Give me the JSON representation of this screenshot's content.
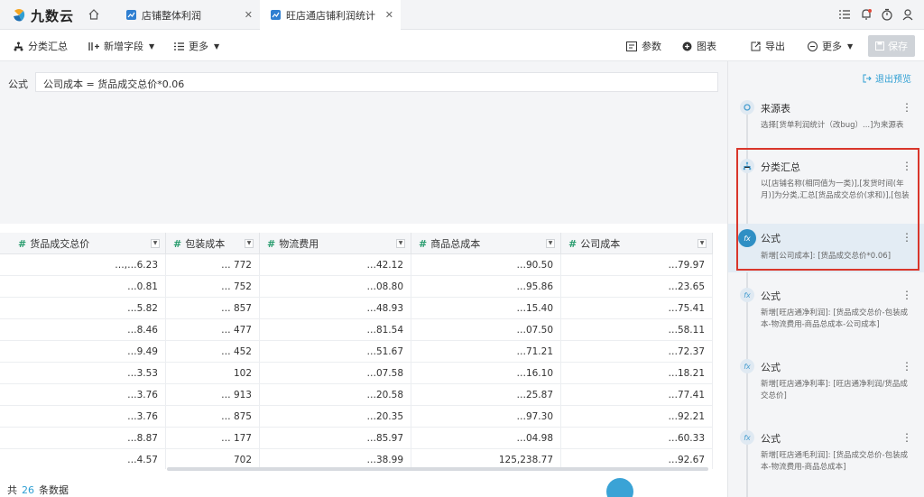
{
  "app": {
    "logo_text": "九数云",
    "tabs": [
      {
        "label": "店铺整体利润",
        "active": false
      },
      {
        "label": "旺店通店铺利润统计",
        "active": true
      }
    ]
  },
  "toolbar": {
    "group_summary": "分类汇总",
    "add_field": "新增字段",
    "more_left": "更多",
    "params": "参数",
    "chart": "图表",
    "export": "导出",
    "more_right": "更多",
    "save": "保存"
  },
  "formula": {
    "label": "公式",
    "value": "公司成本 = 货品成交总价*0.06"
  },
  "table": {
    "columns": [
      "货品成交总价",
      "包装成本",
      "物流费用",
      "商品总成本",
      "公司成本"
    ],
    "rows": [
      [
        "…,…6.23",
        "… 772",
        "…42.12",
        "…90.50",
        "…79.97"
      ],
      [
        "…0.81",
        "… 752",
        "…08.80",
        "…95.86",
        "…23.65"
      ],
      [
        "…5.82",
        "… 857",
        "…48.93",
        "…15.40",
        "…75.41"
      ],
      [
        "…8.46",
        "… 477",
        "…81.54",
        "…07.50",
        "…58.11"
      ],
      [
        "…9.49",
        "… 452",
        "…51.67",
        "…71.21",
        "…72.37"
      ],
      [
        "…3.53",
        "102",
        "…07.58",
        "…16.10",
        "…18.21"
      ],
      [
        "…3.76",
        "… 913",
        "…20.58",
        "…25.87",
        "…77.41"
      ],
      [
        "…3.76",
        "… 875",
        "…20.35",
        "…97.30",
        "…92.21"
      ],
      [
        "…8.87",
        "… 177",
        "…85.97",
        "…04.98",
        "…60.33"
      ],
      [
        "…4.57",
        "702",
        "…38.99",
        "125,238.77",
        "…92.67"
      ]
    ]
  },
  "footer": {
    "prefix": "共",
    "count": "26",
    "suffix": "条数据"
  },
  "panel": {
    "exit_preview": "退出预览",
    "steps": [
      {
        "title": "来源表",
        "desc": "选择[货单利润统计（改bug）...]为来源表"
      },
      {
        "title": "分类汇总",
        "desc": "以[店铺名称(相同值为一类)],[发货时间(年月)]为分类,汇总[货品成交总价(求和)],[包装"
      },
      {
        "title": "公式",
        "desc": "新增[公司成本]: [货品成交总价*0.06]"
      },
      {
        "title": "公式",
        "desc": "新增[旺店通净利润]: [货品成交总价-包装成本-物流费用-商品总成本-公司成本]"
      },
      {
        "title": "公式",
        "desc": "新增[旺店通净利率]: [旺店通净利润/货品成交总价]"
      },
      {
        "title": "公式",
        "desc": "新增[旺店通毛利润]: [货品成交总价-包装成本-物流费用-商品总成本]"
      }
    ]
  },
  "colors": {
    "accent": "#2f9fd3",
    "highlight_border": "#d9362b",
    "field_hash": "#2a9d6f"
  }
}
